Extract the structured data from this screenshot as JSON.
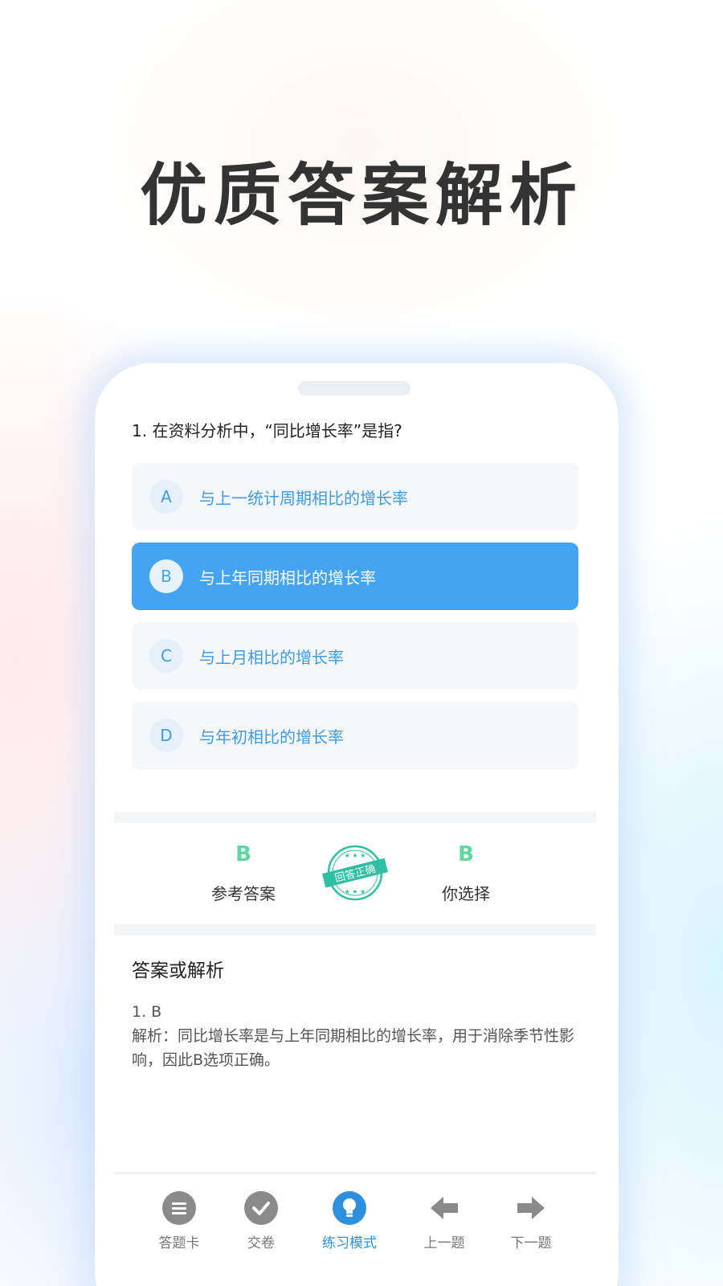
{
  "headline": "优质答案解析",
  "question": {
    "text": "1. 在资料分析中，“同比增长率”是指?"
  },
  "options": [
    {
      "letter": "A",
      "text": "与上一统计周期相比的增长率",
      "selected": false
    },
    {
      "letter": "B",
      "text": "与上年同期相比的增长率",
      "selected": true
    },
    {
      "letter": "C",
      "text": "与上月相比的增长率",
      "selected": false
    },
    {
      "letter": "D",
      "text": "与年初相比的增长率",
      "selected": false
    }
  ],
  "result": {
    "reference_value": "B",
    "reference_label": "参考答案",
    "stamp_text": "回答正确",
    "your_value": "B",
    "your_label": "你选择"
  },
  "analysis": {
    "title": "答案或解析",
    "answer_line": "1. B",
    "explanation": "解析：同比增长率是与上年同期相比的增长率，用于消除季节性影响，因此B选项正确。"
  },
  "tabbar": {
    "items": [
      {
        "label": "答题卡",
        "icon": "list-icon"
      },
      {
        "label": "交卷",
        "icon": "check-icon"
      },
      {
        "label": "练习模式",
        "icon": "lightbulb-icon",
        "active": true
      },
      {
        "label": "上一题",
        "icon": "arrow-left-icon"
      },
      {
        "label": "下一题",
        "icon": "arrow-right-icon"
      }
    ]
  },
  "colors": {
    "accent": "#44a4f1",
    "correct": "#5fd79e",
    "stamp": "#2fbfa2",
    "tab_inactive": "#8a8a8a"
  }
}
